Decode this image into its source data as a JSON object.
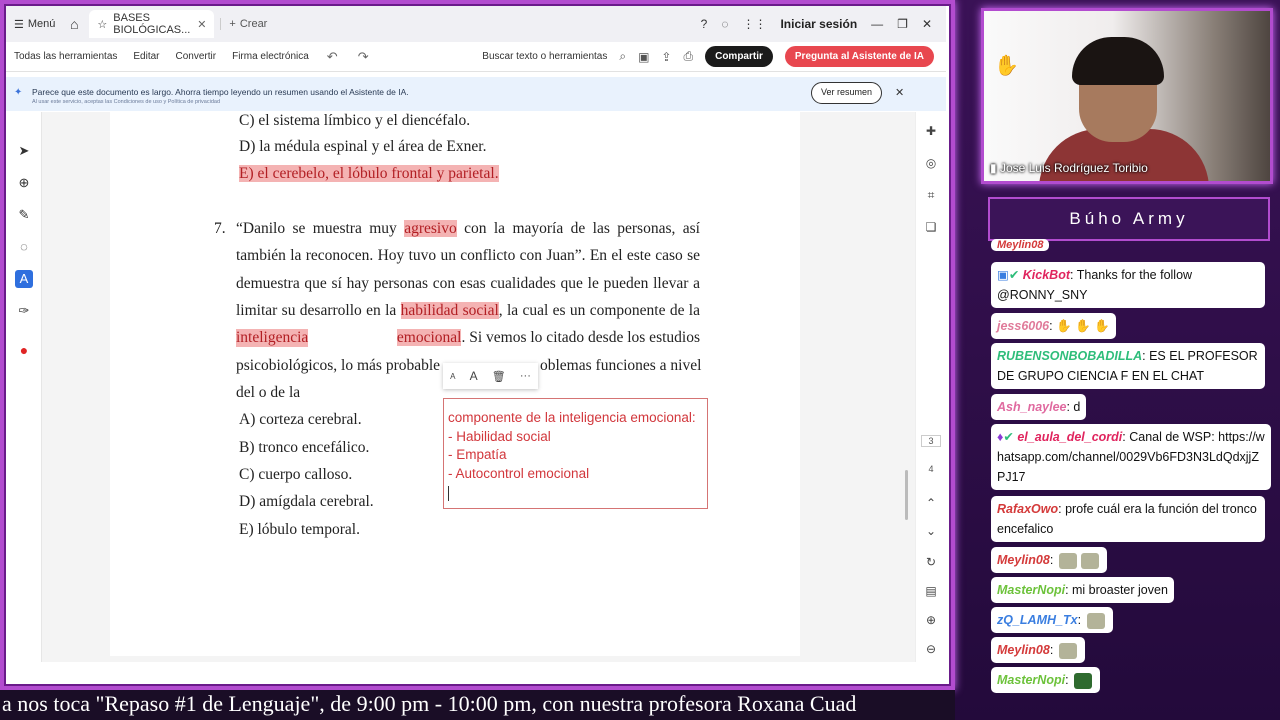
{
  "browser": {
    "menu_label": "Menú",
    "tab_title": "BASES BIOLÓGICAS...",
    "new_tab": "Crear",
    "sign_in": "Iniciar sesión"
  },
  "toolbar": {
    "all_tools": "Todas las herramientas",
    "edit": "Editar",
    "convert": "Convertir",
    "esign": "Firma electrónica",
    "search": "Buscar texto o herramientas",
    "share": "Compartir",
    "ai": "Pregunta al Asistente de IA"
  },
  "banner": {
    "text": "Parece que este documento es largo. Ahorra tiempo leyendo un resumen usando el Asistente de IA.",
    "small": "Al usar este servicio, aceptas las Condiciones de uso y Política de privacidad",
    "button": "Ver resumen"
  },
  "document": {
    "prev_c": "C)  el sistema límbico y el diencéfalo.",
    "prev_d": "D)  la médula espinal y el área de Exner.",
    "prev_e_prefix": "E)  el ",
    "prev_e_w1": "cerebelo",
    "prev_e_mid1": ", el ",
    "prev_e_w2": "lóbulo frontal",
    "prev_e_mid2": " y ",
    "prev_e_w3": "parietal",
    "prev_e_end": ".",
    "q_number": "7.",
    "q_l1_a": "“Danilo se muestra muy ",
    "q_l1_hl": "agresivo",
    "q_l1_b": " con la mayoría de las personas, así",
    "q_l2": "también la reconocen. Hoy tuvo un conflicto con Juan”. En el este caso se",
    "q_l3": "demuestra que sí hay personas con esas cualidades que le pueden llevar a",
    "q_l4_a": "limitar su desarrollo en la ",
    "q_l4_hl": "habilidad social",
    "q_l4_b": ", la cual es un componente de la",
    "q_l5_hl1": "inteligencia",
    "q_l5_hl2": "emocional",
    "q_l5_b": ". Si vemos lo citado desde los estudios",
    "q_l6_a": "psicobiológicos, lo más probable",
    "q_l6_b": "oblemas funciones a nivel",
    "q_l7": "del o de la",
    "opt_a": "A)  corteza cerebral.",
    "opt_b": "B)  tronco encefálico.",
    "opt_c": "C)  cuerpo calloso.",
    "opt_d": "D)  amígdala cerebral.",
    "opt_e": "E)  lóbulo temporal."
  },
  "annotation": {
    "line1": "componente de la inteligencia emocional:",
    "line2": "- Habilidad social",
    "line3": "- Empatía",
    "line4": "- Autocontrol emocional"
  },
  "page_numbers": [
    "3",
    "4"
  ],
  "webcam": {
    "name": "Jose Luis Rodríguez Toribio"
  },
  "chat": {
    "title": "Búho Army",
    "top_user": "Meylin08",
    "messages": [
      {
        "user": "KickBot",
        "color": "#e0245e",
        "text": ": Thanks for the follow @RONNY_SNY"
      },
      {
        "user": "jess6006",
        "color": "#e07a9a",
        "text": ":"
      },
      {
        "user": "RUBENSONBOBADILLA",
        "color": "#2ebd7a",
        "text": ": ES EL PROFESOR DE GRUPO CIENCIA F EN EL CHAT"
      },
      {
        "user": "Ash_naylee",
        "color": "#e06aa0",
        "text": ": d"
      },
      {
        "user": "el_aula_del_cordi",
        "color": "#e0245e",
        "text": ": Canal de WSP: https://whatsapp.com/channel/0029Vb6FD3N3LdQdxjjZPJ17"
      },
      {
        "user": "RafaxOwo",
        "color": "#d43a3a",
        "text": ": profe cuál era la función del tronco encefalico"
      },
      {
        "user": "Meylin08",
        "color": "#d43a3a",
        "text": ":"
      },
      {
        "user": "MasterNopi",
        "color": "#6cc23a",
        "text": ": mi broaster joven"
      },
      {
        "user": "zQ_LAMH_Tx",
        "color": "#3a7ee0",
        "text": ":"
      },
      {
        "user": "Meylin08",
        "color": "#d43a3a",
        "text": ":"
      },
      {
        "user": "MasterNopi",
        "color": "#6cc23a",
        "text": ":"
      }
    ]
  },
  "ticker": "a nos toca \"Repaso #1 de Lenguaje\", de 9:00 pm - 10:00 pm, con nuestra profesora Roxana Cuad"
}
